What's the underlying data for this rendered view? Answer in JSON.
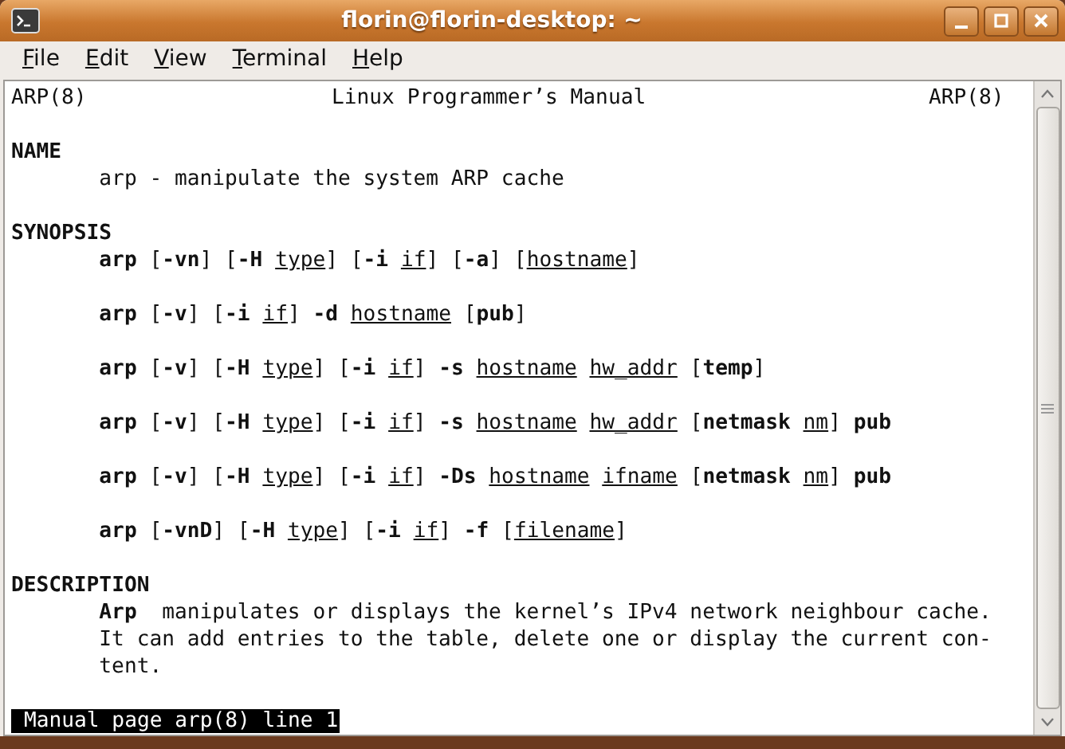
{
  "window": {
    "title": "florin@florin-desktop: ~"
  },
  "menu": [
    "File",
    "Edit",
    "View",
    "Terminal",
    "Help"
  ],
  "header": {
    "left": "ARP(8)",
    "center": "Linux Programmer’s Manual",
    "right": "ARP(8)"
  },
  "lines": [
    {
      "kind": "blank"
    },
    {
      "kind": "heading",
      "segments": [
        {
          "text": "NAME",
          "kind": "option"
        }
      ]
    },
    {
      "kind": "body",
      "segments": [
        {
          "text": "arp - manipulate the system ARP cache",
          "kind": "text"
        }
      ]
    },
    {
      "kind": "blank"
    },
    {
      "kind": "heading",
      "segments": [
        {
          "text": "SYNOPSIS",
          "kind": "option"
        }
      ]
    },
    {
      "kind": "body",
      "segments": [
        {
          "text": "arp",
          "kind": "option"
        },
        {
          "text": " [",
          "kind": "text"
        },
        {
          "text": "-vn",
          "kind": "option"
        },
        {
          "text": "] [",
          "kind": "text"
        },
        {
          "text": "-H ",
          "kind": "option"
        },
        {
          "text": "type",
          "kind": "argument"
        },
        {
          "text": "] [",
          "kind": "text"
        },
        {
          "text": "-i ",
          "kind": "option"
        },
        {
          "text": "if",
          "kind": "argument"
        },
        {
          "text": "] [",
          "kind": "text"
        },
        {
          "text": "-a",
          "kind": "option"
        },
        {
          "text": "] [",
          "kind": "text"
        },
        {
          "text": "hostname",
          "kind": "argument"
        },
        {
          "text": "]",
          "kind": "text"
        }
      ]
    },
    {
      "kind": "blank"
    },
    {
      "kind": "body",
      "segments": [
        {
          "text": "arp",
          "kind": "option"
        },
        {
          "text": " [",
          "kind": "text"
        },
        {
          "text": "-v",
          "kind": "option"
        },
        {
          "text": "] [",
          "kind": "text"
        },
        {
          "text": "-i ",
          "kind": "option"
        },
        {
          "text": "if",
          "kind": "argument"
        },
        {
          "text": "] ",
          "kind": "text"
        },
        {
          "text": "-d ",
          "kind": "option"
        },
        {
          "text": "hostname",
          "kind": "argument"
        },
        {
          "text": " [",
          "kind": "text"
        },
        {
          "text": "pub",
          "kind": "option"
        },
        {
          "text": "]",
          "kind": "text"
        }
      ]
    },
    {
      "kind": "blank"
    },
    {
      "kind": "body",
      "segments": [
        {
          "text": "arp",
          "kind": "option"
        },
        {
          "text": " [",
          "kind": "text"
        },
        {
          "text": "-v",
          "kind": "option"
        },
        {
          "text": "] [",
          "kind": "text"
        },
        {
          "text": "-H ",
          "kind": "option"
        },
        {
          "text": "type",
          "kind": "argument"
        },
        {
          "text": "] [",
          "kind": "text"
        },
        {
          "text": "-i ",
          "kind": "option"
        },
        {
          "text": "if",
          "kind": "argument"
        },
        {
          "text": "] ",
          "kind": "text"
        },
        {
          "text": "-s ",
          "kind": "option"
        },
        {
          "text": "hostname",
          "kind": "argument"
        },
        {
          "text": "hw_addr",
          "kind": "argument"
        },
        {
          "text": " [",
          "kind": "text"
        },
        {
          "text": "temp",
          "kind": "option"
        },
        {
          "text": "]",
          "kind": "text"
        }
      ]
    },
    {
      "kind": "blank"
    },
    {
      "kind": "body",
      "segments": [
        {
          "text": "arp",
          "kind": "option"
        },
        {
          "text": " [",
          "kind": "text"
        },
        {
          "text": "-v",
          "kind": "option"
        },
        {
          "text": "] [",
          "kind": "text"
        },
        {
          "text": "-H ",
          "kind": "option"
        },
        {
          "text": "type",
          "kind": "argument"
        },
        {
          "text": "] [",
          "kind": "text"
        },
        {
          "text": "-i ",
          "kind": "option"
        },
        {
          "text": "if",
          "kind": "argument"
        },
        {
          "text": "] ",
          "kind": "text"
        },
        {
          "text": "-s ",
          "kind": "option"
        },
        {
          "text": "hostname",
          "kind": "argument"
        },
        {
          "text": "hw_addr",
          "kind": "argument"
        },
        {
          "text": " [",
          "kind": "text"
        },
        {
          "text": "netmask ",
          "kind": "option"
        },
        {
          "text": "nm",
          "kind": "argument"
        },
        {
          "text": "] ",
          "kind": "text"
        },
        {
          "text": "pub",
          "kind": "option"
        }
      ]
    },
    {
      "kind": "blank"
    },
    {
      "kind": "body",
      "segments": [
        {
          "text": "arp",
          "kind": "option"
        },
        {
          "text": " [",
          "kind": "text"
        },
        {
          "text": "-v",
          "kind": "option"
        },
        {
          "text": "] [",
          "kind": "text"
        },
        {
          "text": "-H ",
          "kind": "option"
        },
        {
          "text": "type",
          "kind": "argument"
        },
        {
          "text": "] [",
          "kind": "text"
        },
        {
          "text": "-i ",
          "kind": "option"
        },
        {
          "text": "if",
          "kind": "argument"
        },
        {
          "text": "] ",
          "kind": "text"
        },
        {
          "text": "-Ds ",
          "kind": "option"
        },
        {
          "text": "hostname",
          "kind": "argument"
        },
        {
          "text": "ifname",
          "kind": "argument"
        },
        {
          "text": " [",
          "kind": "text"
        },
        {
          "text": "netmask ",
          "kind": "option"
        },
        {
          "text": "nm",
          "kind": "argument"
        },
        {
          "text": "] ",
          "kind": "text"
        },
        {
          "text": "pub",
          "kind": "option"
        }
      ]
    },
    {
      "kind": "blank"
    },
    {
      "kind": "body",
      "segments": [
        {
          "text": "arp",
          "kind": "option"
        },
        {
          "text": " [",
          "kind": "text"
        },
        {
          "text": "-vnD",
          "kind": "option"
        },
        {
          "text": "] [",
          "kind": "text"
        },
        {
          "text": "-H ",
          "kind": "option"
        },
        {
          "text": "type",
          "kind": "argument"
        },
        {
          "text": "] [",
          "kind": "text"
        },
        {
          "text": "-i ",
          "kind": "option"
        },
        {
          "text": "if",
          "kind": "argument"
        },
        {
          "text": "] ",
          "kind": "text"
        },
        {
          "text": "-f",
          "kind": "option"
        },
        {
          "text": " [",
          "kind": "text"
        },
        {
          "text": "filename",
          "kind": "argument"
        },
        {
          "text": "]",
          "kind": "text"
        }
      ]
    },
    {
      "kind": "blank"
    },
    {
      "kind": "heading",
      "segments": [
        {
          "text": "DESCRIPTION",
          "kind": "option"
        }
      ]
    },
    {
      "kind": "body",
      "segments": [
        {
          "text": "Arp",
          "kind": "option"
        },
        {
          "text": "  manipulates or displays the kernel’s IPv4 network neighbour cache.",
          "kind": "text"
        }
      ]
    },
    {
      "kind": "body",
      "segments": [
        {
          "text": "It can add entries to the table, delete one or display the current con-",
          "kind": "text"
        }
      ]
    },
    {
      "kind": "body",
      "segments": [
        {
          "text": "tent.",
          "kind": "text"
        }
      ]
    },
    {
      "kind": "blank"
    }
  ],
  "status_line": "Manual page arp(8) line 1"
}
